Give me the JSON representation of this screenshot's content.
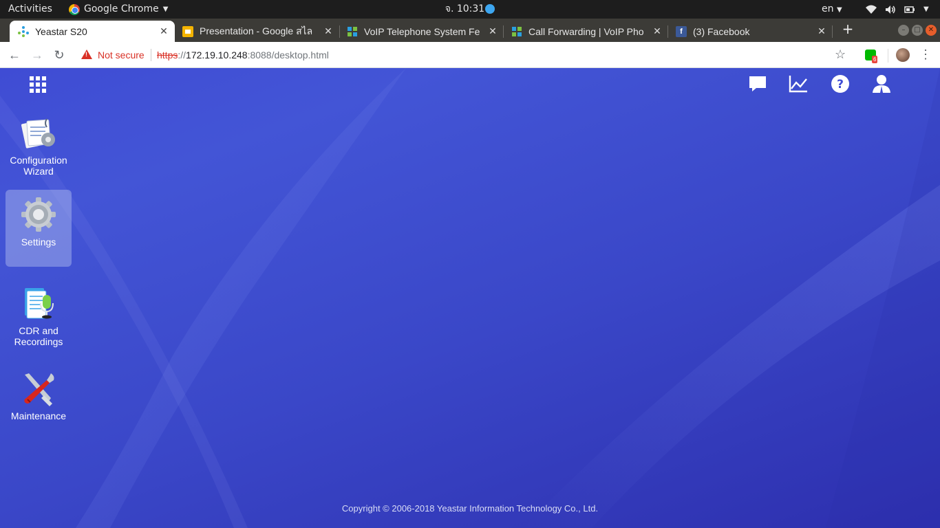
{
  "system_bar": {
    "activities": "Activities",
    "app_name": "Google Chrome",
    "clock": "จ. 10:31",
    "language": "en"
  },
  "browser": {
    "tabs": [
      {
        "title": "Yeastar S20",
        "favicon": "yeastar-icon",
        "active": true
      },
      {
        "title": "Presentation - Google สไล",
        "favicon": "google-slides-icon",
        "active": false
      },
      {
        "title": "VoIP Telephone System Fe",
        "favicon": "voip-site-icon",
        "active": false
      },
      {
        "title": "Call Forwarding | VoIP Pho",
        "favicon": "voip-site-icon",
        "active": false
      },
      {
        "title": "(3) Facebook",
        "favicon": "facebook-icon",
        "active": false
      }
    ],
    "security_label": "Not secure",
    "url": {
      "scheme": "https",
      "separator": "://",
      "host": "172.19.10.248",
      "rest": ":8088/desktop.html"
    },
    "extension_badge": "6"
  },
  "desktop": {
    "apps": [
      {
        "label_line1": "Configuration",
        "label_line2": "Wizard",
        "icon": "configuration-wizard-icon"
      },
      {
        "label_line1": "Settings",
        "label_line2": "",
        "icon": "settings-gear-icon",
        "selected": true
      },
      {
        "label_line1": "CDR and",
        "label_line2": "Recordings",
        "icon": "cdr-recordings-icon"
      },
      {
        "label_line1": "Maintenance",
        "label_line2": "",
        "icon": "maintenance-tools-icon"
      }
    ],
    "top_icons": [
      "message-icon",
      "statistics-chart-icon",
      "help-icon",
      "user-account-icon"
    ],
    "copyright": "Copyright © 2006-2018 Yeastar Information Technology Co., Ltd."
  },
  "colors": {
    "desktop_background": "#3f4cd4",
    "chrome_dark": "#3c3b37",
    "not_secure_red": "#d93025"
  }
}
